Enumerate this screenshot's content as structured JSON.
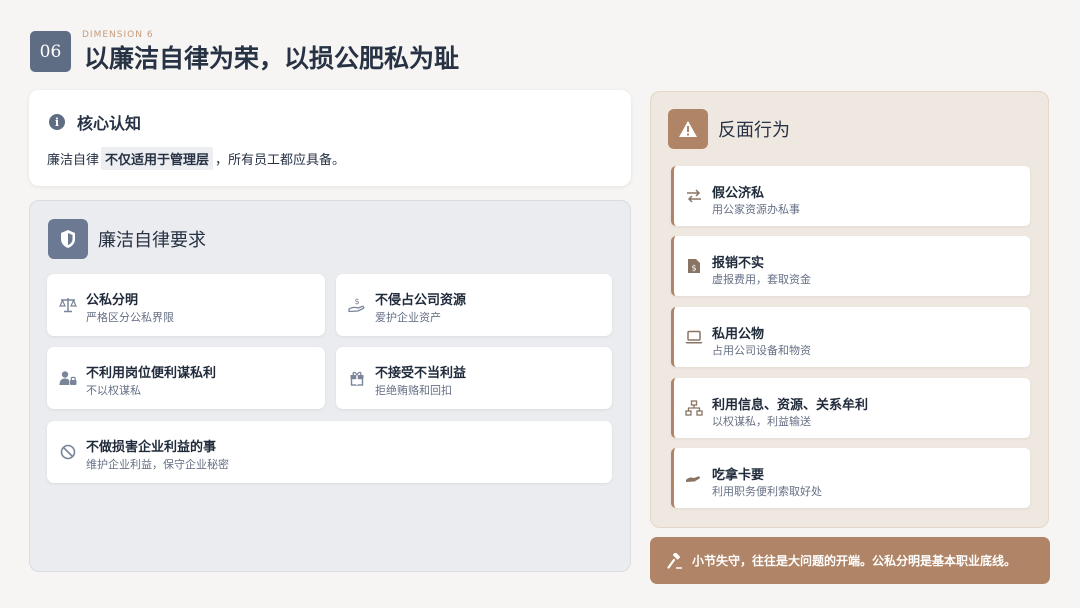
{
  "header": {
    "number": "06",
    "dimension_label": "DIMENSION 6",
    "title": "以廉洁自律为荣，以损公肥私为耻"
  },
  "core": {
    "title": "核心认知",
    "text_before": "廉洁自律",
    "highlight": "不仅适用于管理层",
    "text_after": "，所有员工都应具备。"
  },
  "requirements": {
    "title": "廉洁自律要求",
    "items": [
      {
        "title": "公私分明",
        "desc": "严格区分公私界限",
        "icon": "scale-icon"
      },
      {
        "title": "不侵占公司资源",
        "desc": "爱护企业资产",
        "icon": "hand-money-icon"
      },
      {
        "title": "不利用岗位便利谋私利",
        "desc": "不以权谋私",
        "icon": "user-lock-icon"
      },
      {
        "title": "不接受不当利益",
        "desc": "拒绝贿赂和回扣",
        "icon": "gift-icon"
      },
      {
        "title": "不做损害企业利益的事",
        "desc": "维护企业利益，保守企业秘密",
        "icon": "ban-icon"
      }
    ]
  },
  "negatives": {
    "title": "反面行为",
    "items": [
      {
        "title": "假公济私",
        "desc": "用公家资源办私事",
        "icon": "exchange-icon"
      },
      {
        "title": "报销不实",
        "desc": "虚报费用，套取资金",
        "icon": "invoice-icon"
      },
      {
        "title": "私用公物",
        "desc": "占用公司设备和物资",
        "icon": "laptop-icon"
      },
      {
        "title": "利用信息、资源、关系牟利",
        "desc": "以权谋私，利益输送",
        "icon": "network-icon"
      },
      {
        "title": "吃拿卡要",
        "desc": "利用职务便利索取好处",
        "icon": "hand-take-icon"
      }
    ]
  },
  "banner": {
    "text": "小节失守，往往是大问题的开端。公私分明是基本职业底线。",
    "icon": "gavel-icon"
  },
  "colors": {
    "slate": "#5f6d84",
    "bronze": "#b08466",
    "text": "#1f2a3a"
  }
}
